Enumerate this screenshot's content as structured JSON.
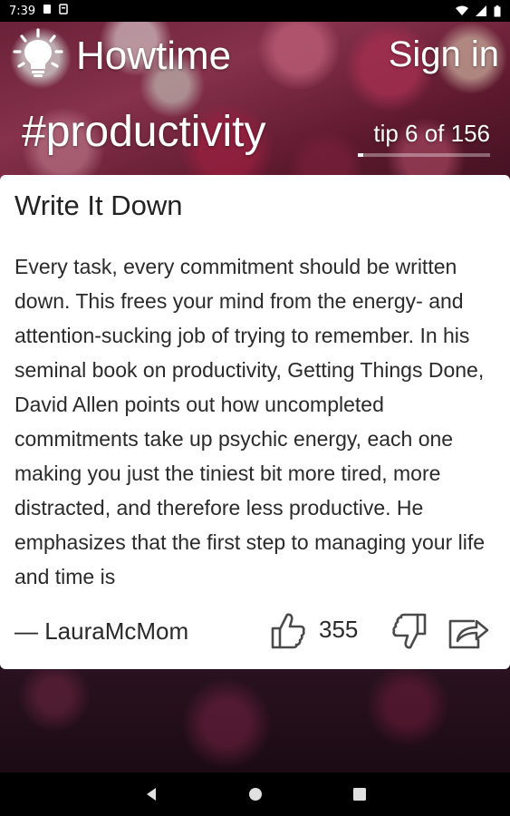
{
  "status_bar": {
    "time": "7:39"
  },
  "header": {
    "app_title": "Howtime",
    "sign_in_label": "Sign in",
    "hashtag": "#productivity",
    "tip_counter": "tip 6 of 156",
    "tip_progress": 0.038
  },
  "card": {
    "title": "Write It Down",
    "body": "Every task, every commitment should be written down. This frees your mind from the energy- and attention-sucking job of trying to remember. In his seminal book on productivity, Getting Things Done, David Allen points out how uncompleted commitments take up psychic energy, each one making you just the tiniest bit more tired, more distracted, and therefore less productive. He emphasizes that the first step to managing your life and time is",
    "author": "— LauraMcMom",
    "like_count": "355"
  },
  "icons": {
    "logo": "lightbulb-icon",
    "like": "thumbs-up-icon",
    "dislike": "thumbs-down-icon",
    "share": "share-icon",
    "back": "back-triangle-icon",
    "home": "home-circle-icon",
    "recents": "recents-square-icon"
  },
  "colors": {
    "card_bg": "#ffffff",
    "text": "#2a2a2a",
    "header_text": "#ffffff"
  }
}
